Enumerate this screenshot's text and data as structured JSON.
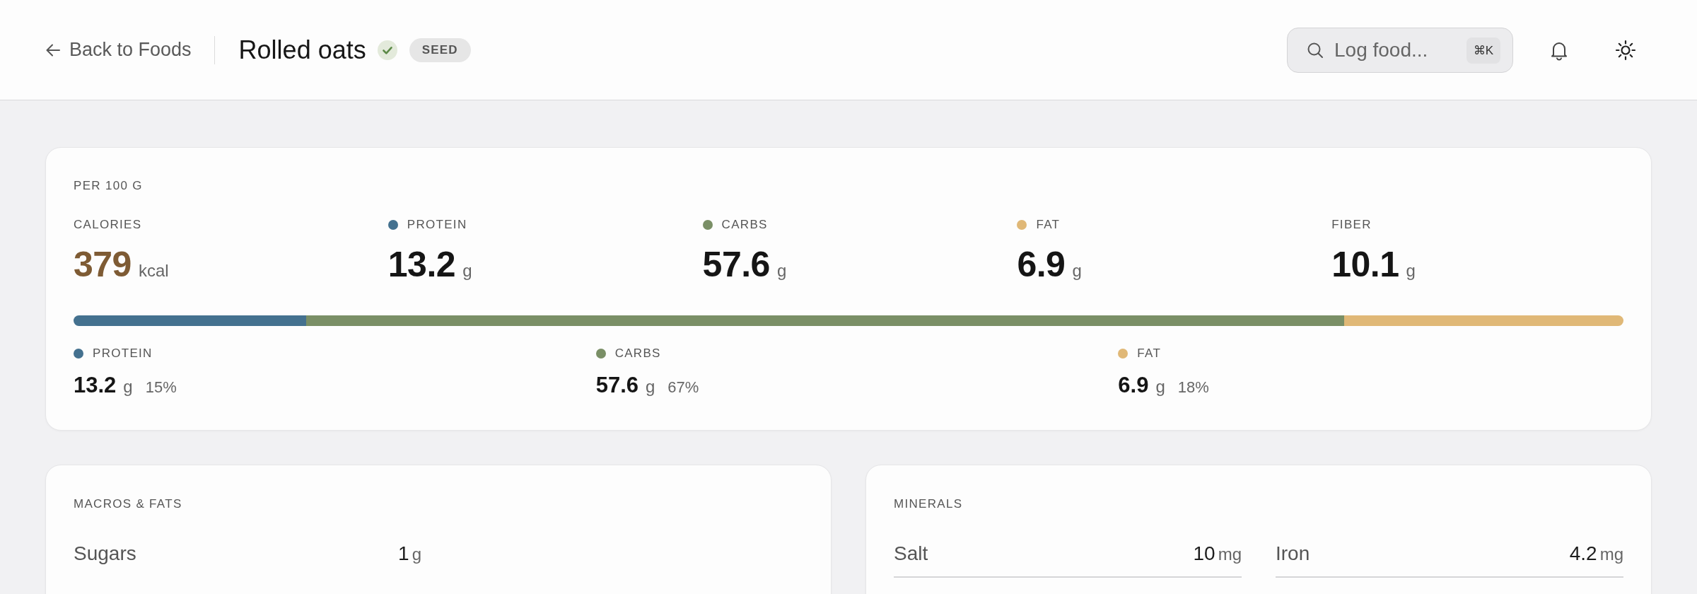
{
  "header": {
    "back_link": "Back to Foods",
    "title": "Rolled oats",
    "verified": true,
    "badge": "SEED",
    "search": {
      "placeholder": "Log food...",
      "shortcut": "⌘K"
    }
  },
  "summary": {
    "heading": "PER 100 G",
    "stats": [
      {
        "kind": "energy",
        "label": "CALORIES",
        "value": "379",
        "unit": "kcal"
      },
      {
        "kind": "nutrient",
        "label": "PROTEIN",
        "value": "13.2",
        "unit": "g",
        "color": "#44718f"
      },
      {
        "kind": "nutrient",
        "label": "CARBS",
        "value": "57.6",
        "unit": "g",
        "color": "#7a8f66"
      },
      {
        "kind": "nutrient",
        "label": "FAT",
        "value": "6.9",
        "unit": "g",
        "color": "#e0b877"
      },
      {
        "kind": "nutrient",
        "label": "FIBER",
        "value": "10.1",
        "unit": "g"
      }
    ],
    "macro_split": [
      {
        "label": "PROTEIN",
        "value": "13.2",
        "unit": "g",
        "percent": "15%",
        "color": "#44718f"
      },
      {
        "label": "CARBS",
        "value": "57.6",
        "unit": "g",
        "percent": "67%",
        "color": "#7a8f66"
      },
      {
        "label": "FAT",
        "value": "6.9",
        "unit": "g",
        "percent": "18%",
        "color": "#e0b877"
      }
    ]
  },
  "sections": [
    {
      "title": "MACROS & FATS",
      "ruled": false,
      "rows": [
        {
          "label": "Sugars",
          "value": "1",
          "unit": "g"
        }
      ]
    },
    {
      "title": "MINERALS",
      "ruled": true,
      "rows": [
        {
          "label": "Salt",
          "value": "10",
          "unit": "mg"
        },
        {
          "label": "Iron",
          "value": "4.2",
          "unit": "mg"
        }
      ]
    }
  ]
}
